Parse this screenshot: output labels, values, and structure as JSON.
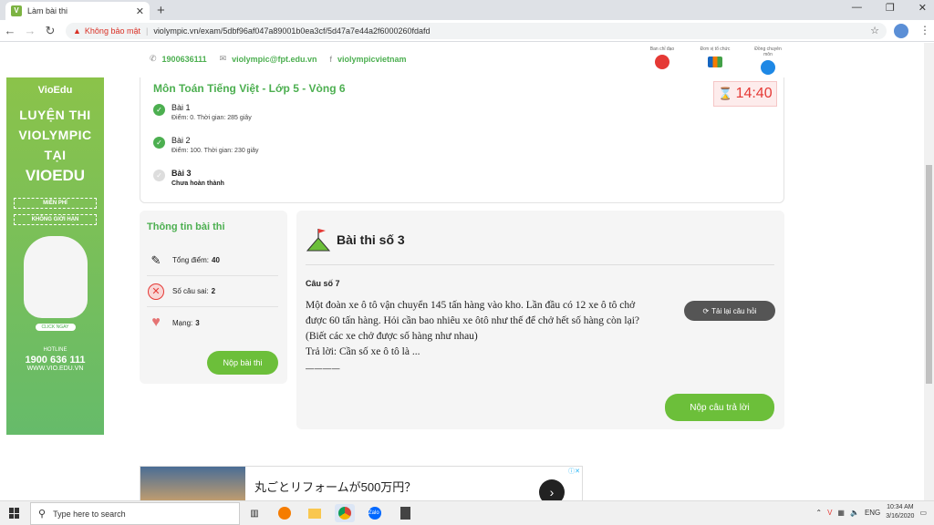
{
  "browser": {
    "tab_title": "Làm bài thi",
    "new_tab": "+",
    "insecure_label": "Không bảo mật",
    "url": "violympic.vn/exam/5dbf96af047a89001b0ea3cf/5d47a7e44a2f6000260fdafd"
  },
  "topbar": {
    "phone": "1900636111",
    "email": "violympic@fpt.edu.vn",
    "facebook": "violympicvietnam",
    "partners": [
      "Ban chỉ đạo",
      "Đơn vị tổ chức",
      "Đồng chuyên môn"
    ]
  },
  "banner": {
    "brand": "VioEdu",
    "line1": "LUYỆN THI",
    "line2": "VIOLYMPIC",
    "line3": "TẠI",
    "line4": "VIOEDU",
    "pill1": "MIỄN PHÍ",
    "pill2": "KHÔNG GIỚI HẠN",
    "click": "CLICK NGAY",
    "hotline_label": "HOTLINE",
    "hotline": "1900 636 111",
    "website": "WWW.VIO.EDU.VN"
  },
  "exam": {
    "title": "Môn Toán Tiếng Việt - Lớp 5 - Vòng 6",
    "timer": "14:40",
    "lessons": [
      {
        "name": "Bài 1",
        "desc": "Điểm: 0. Thời gian: 285 giây",
        "done": true
      },
      {
        "name": "Bài 2",
        "desc": "Điểm: 100. Thời gian: 230 giây",
        "done": true
      },
      {
        "name": "Bài 3",
        "desc": "Chưa hoàn thành",
        "done": false
      }
    ]
  },
  "info": {
    "title": "Thông tin bài thi",
    "total_label": "Tổng điểm:",
    "total_value": "40",
    "wrong_label": "Số câu sai:",
    "wrong_value": "2",
    "lives_label": "Mạng:",
    "lives_value": "3",
    "submit_exam": "Nộp bài thi"
  },
  "question": {
    "heading": "Bài thi số 3",
    "number": "Câu số 7",
    "text": "Một đoàn xe ô tô vận chuyển 145 tấn hàng vào kho. Lần đầu có 12 xe ô tô chở được 60 tấn hàng. Hỏi cần bao nhiêu xe ôtô như thế để chở hết số hàng còn lại? (Biết các xe chở được số hàng như nhau)",
    "answer_prefix": "Trả lời: Cần số xe ô tô là  ...",
    "reload": "Tải lại câu hỏi",
    "submit_answer": "Nộp câu trả lời"
  },
  "ad": {
    "text": "丸ごとリフォームが500万円？",
    "arrow": "›"
  },
  "taskbar": {
    "search_placeholder": "Type here to search",
    "language": "ENG",
    "time": "10:34 AM",
    "date": "3/16/2020"
  },
  "colors": {
    "green": "#4caf50",
    "button_green": "#6cbf3a",
    "timer_red": "#e53935"
  }
}
